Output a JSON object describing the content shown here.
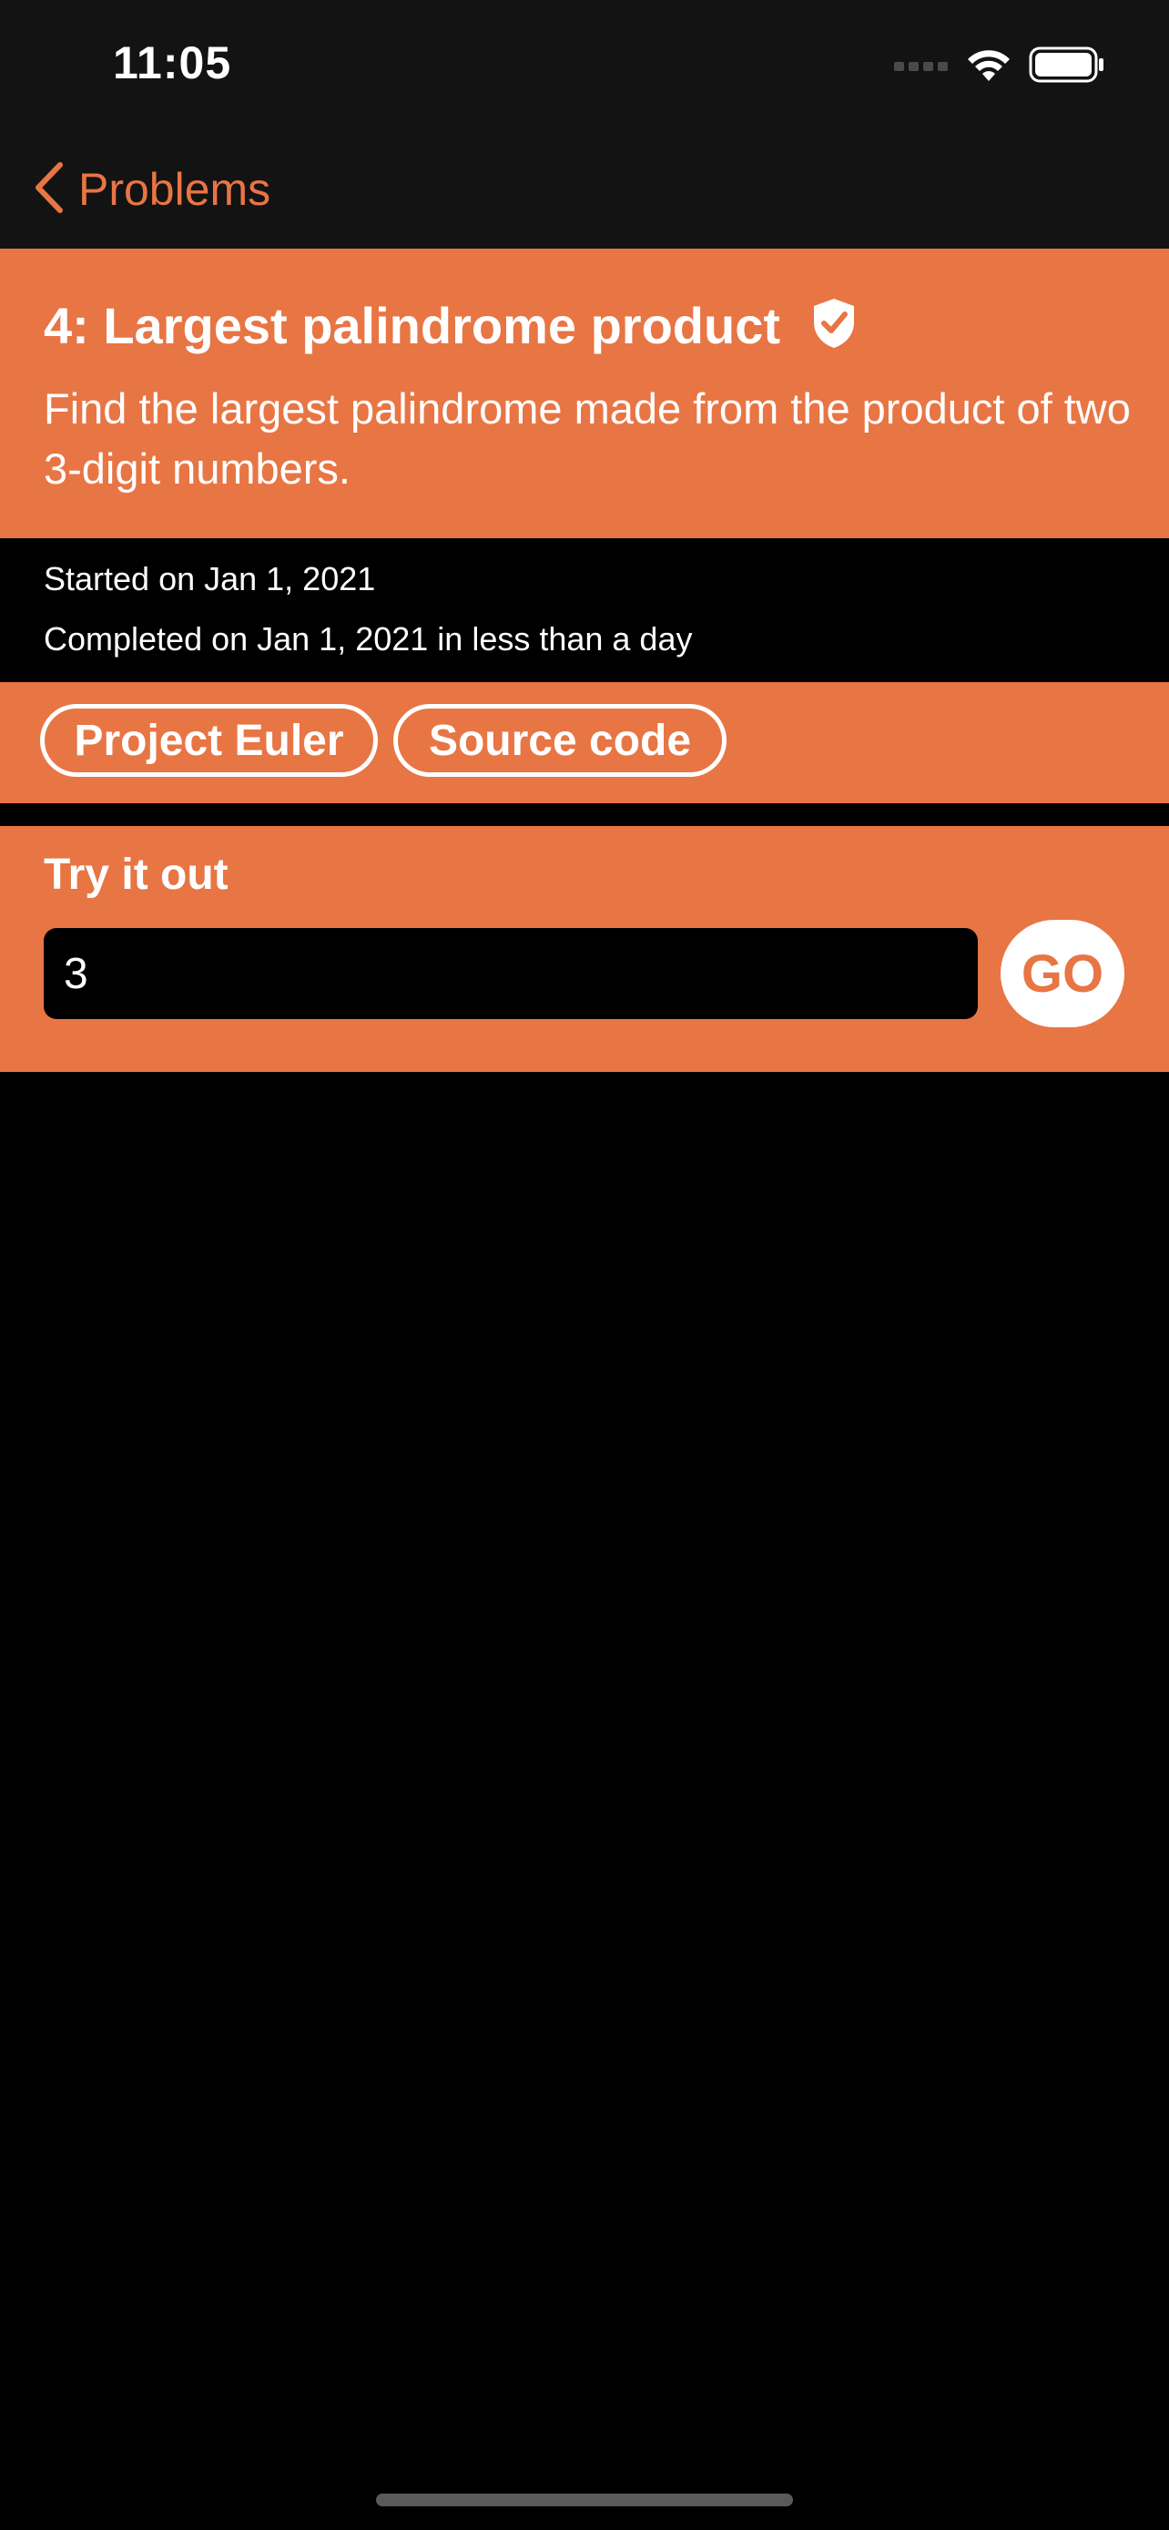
{
  "status_bar": {
    "time": "11:05",
    "icons": [
      "cellular-signal-icon",
      "wifi-icon",
      "battery-icon"
    ]
  },
  "nav": {
    "back_label": "Problems",
    "back_icon": "chevron-left-icon",
    "accent_color": "#e87544"
  },
  "problem": {
    "title": "4: Largest palindrome product",
    "verified_icon": "shield-check-icon",
    "description": "Find the largest palindrome made from the product of two 3-digit numbers.",
    "started": "Started on Jan 1, 2021",
    "completed": "Completed on Jan 1, 2021 in less than a day"
  },
  "links": {
    "project_euler": "Project Euler",
    "source_code": "Source code"
  },
  "try_it": {
    "title": "Try it out",
    "input_value": "3",
    "go_label": "GO"
  },
  "colors": {
    "accent": "#e87544",
    "background": "#000000",
    "bar": "#131313"
  }
}
